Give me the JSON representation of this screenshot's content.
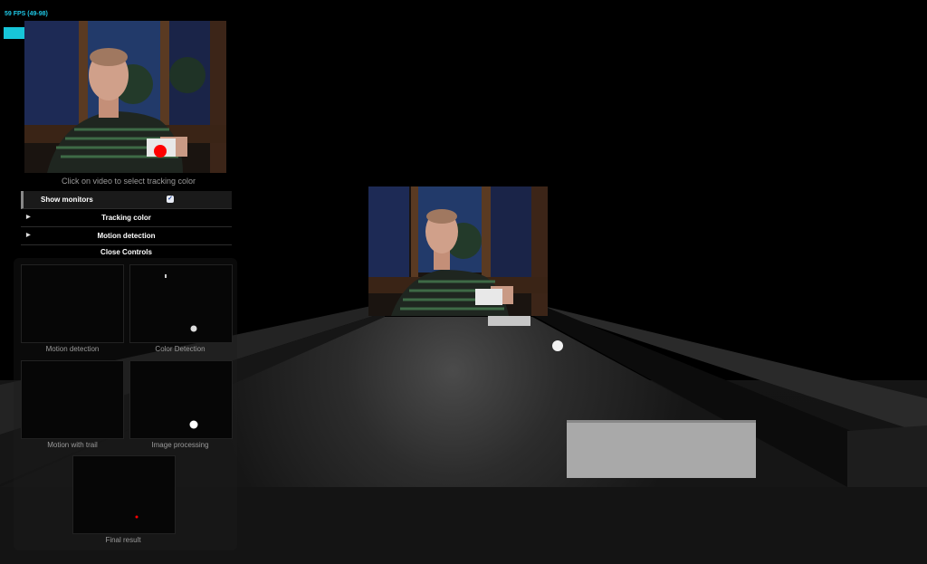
{
  "stats": {
    "fps_text": "59 FPS (49-98)"
  },
  "webcam": {
    "caption": "Click on video to select tracking color"
  },
  "controls": {
    "show_monitors_label": "Show monitors",
    "show_monitors_checked": true,
    "tracking_color_label": "Tracking color",
    "motion_detection_label": "Motion detection",
    "close_controls_label": "Close Controls"
  },
  "monitors": {
    "motion_detection": "Motion detection",
    "color_detection": "Color Detection",
    "motion_with_trail": "Motion with trail",
    "image_processing": "Image processing",
    "final_result": "Final result"
  },
  "colors": {
    "tracking_marker": "#ff0000",
    "fps_accent": "#17c6d9"
  }
}
